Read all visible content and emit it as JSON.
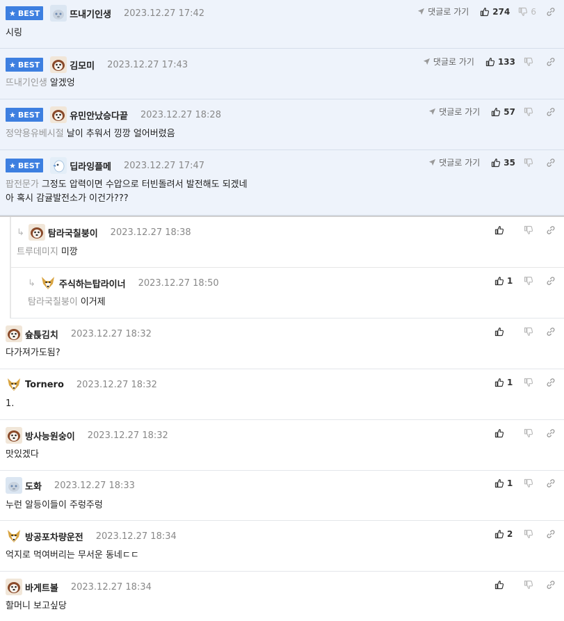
{
  "best_label": "BEST",
  "goto_label": "댓글로 가기",
  "comments": [
    {
      "nick": "뜨내기인생",
      "date": "2023.12.27 17:42",
      "mention": "",
      "text": "시링",
      "text2": "",
      "likes": "274",
      "dislikes": "6",
      "best": true,
      "avatar": "avatar-cat-icon"
    },
    {
      "nick": "김모미",
      "date": "2023.12.27 17:43",
      "mention": "뜨내기인생",
      "text": "알겠엉",
      "text2": "",
      "likes": "133",
      "dislikes": "",
      "best": true,
      "avatar": "avatar-dog-icon"
    },
    {
      "nick": "유민안났승다끝",
      "date": "2023.12.27 18:28",
      "mention": "정약용유베시절",
      "text": "날이 추워서 낑깡 얼어버렸음",
      "text2": "",
      "likes": "57",
      "dislikes": "",
      "best": true,
      "avatar": "avatar-dog-icon"
    },
    {
      "nick": "딥라잉플메",
      "date": "2023.12.27 17:47",
      "mention": "팝전문가",
      "text": "그정도 압력이면 수압으로 터빈돌려서 발전해도 되겠네",
      "text2": "아 혹시 감귤발전소가 이건가???",
      "likes": "35",
      "dislikes": "",
      "best": true,
      "avatar": "avatar-bird-icon"
    },
    {
      "nick": "탐라국칠붕이",
      "date": "2023.12.27 18:38",
      "mention": "트루데미지",
      "text": "미깡",
      "text2": "",
      "likes": "",
      "dislikes": "",
      "best": false,
      "avatar": "avatar-dog-icon"
    },
    {
      "nick": "주식하는탑라이너",
      "date": "2023.12.27 18:50",
      "mention": "탐라국칠붕이",
      "text": "이거제",
      "text2": "",
      "likes": "1",
      "dislikes": "",
      "best": false,
      "avatar": "avatar-fox-icon"
    },
    {
      "nick": "슢튽김치",
      "date": "2023.12.27 18:32",
      "mention": "",
      "text": "다가져가도됨?",
      "text2": "",
      "likes": "",
      "dislikes": "",
      "best": false,
      "avatar": "avatar-dog-icon"
    },
    {
      "nick": "Tornero",
      "date": "2023.12.27 18:32",
      "mention": "",
      "text": "1.",
      "text2": "",
      "likes": "1",
      "dislikes": "",
      "best": false,
      "avatar": "avatar-fox-icon"
    },
    {
      "nick": "방사능원숭이",
      "date": "2023.12.27 18:32",
      "mention": "",
      "text": "맛있겠다",
      "text2": "",
      "likes": "",
      "dislikes": "",
      "best": false,
      "avatar": "avatar-dog-icon"
    },
    {
      "nick": "도화",
      "date": "2023.12.27 18:33",
      "mention": "",
      "text": "누런 알등이들이 주렁주렁",
      "text2": "",
      "likes": "1",
      "dislikes": "",
      "best": false,
      "avatar": "avatar-cat-icon"
    },
    {
      "nick": "방공포차량운전",
      "date": "2023.12.27 18:34",
      "mention": "",
      "text": "억지로 먹여버리는 무서운 동네ㄷㄷ",
      "text2": "",
      "likes": "2",
      "dislikes": "",
      "best": false,
      "avatar": "avatar-fox-icon"
    },
    {
      "nick": "바게트볼",
      "date": "2023.12.27 18:34",
      "mention": "",
      "text": "할머니 보고싶당",
      "text2": "",
      "likes": "",
      "dislikes": "",
      "best": false,
      "avatar": "avatar-dog-icon"
    }
  ]
}
